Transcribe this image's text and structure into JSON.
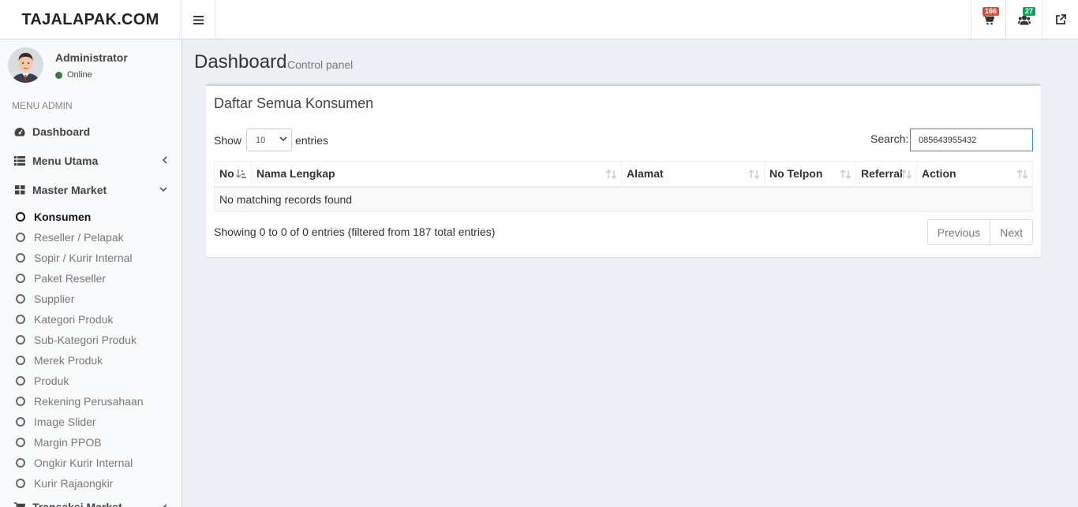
{
  "header": {
    "logo": "TAJALAPAK.COM",
    "cart_badge": "166",
    "users_badge": "27",
    "cart_badge_color": "#dd4b39",
    "users_badge_color": "#00a65a"
  },
  "user": {
    "name": "Administrator",
    "status": "Online"
  },
  "sidebar": {
    "header": "MENU ADMIN",
    "items": [
      {
        "label": "Dashboard",
        "icon": "dashboard-icon"
      },
      {
        "label": "Menu Utama",
        "icon": "list-icon"
      },
      {
        "label": "Master Market",
        "icon": "grid-icon"
      }
    ],
    "subitems": [
      "Konsumen",
      "Reseller / Pelapak",
      "Sopir / Kurir Internal",
      "Paket Reseller",
      "Supplier",
      "Kategori Produk",
      "Sub-Kategori Produk",
      "Merek Produk",
      "Produk",
      "Rekening Perusahaan",
      "Image Slider",
      "Margin PPOB",
      "Ongkir Kurir Internal",
      "Kurir Rajaongkir"
    ],
    "next_item": "Transaksi Market"
  },
  "content": {
    "title": "Dashboard",
    "subtitle": "Control panel"
  },
  "box": {
    "title": "Daftar Semua Konsumen",
    "show_label": "Show",
    "entries_label": "entries",
    "page_size": "10",
    "search_label": "Search:",
    "search_value": "085643955432",
    "columns": [
      "No",
      "Nama Lengkap",
      "Alamat",
      "No Telpon",
      "Referral",
      "Action"
    ],
    "empty_message": "No matching records found",
    "info": "Showing 0 to 0 of 0 entries (filtered from 187 total entries)",
    "prev": "Previous",
    "next": "Next"
  }
}
